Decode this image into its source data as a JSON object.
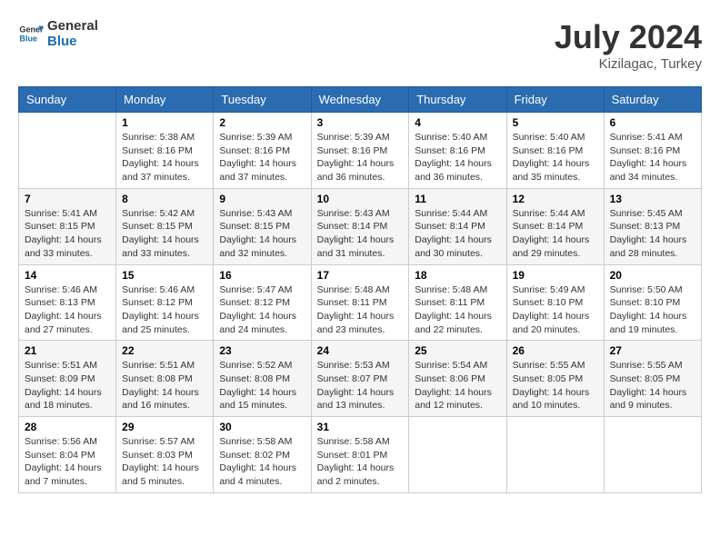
{
  "logo": {
    "text_general": "General",
    "text_blue": "Blue"
  },
  "title": {
    "month_year": "July 2024",
    "location": "Kizilagac, Turkey"
  },
  "days_of_week": [
    "Sunday",
    "Monday",
    "Tuesday",
    "Wednesday",
    "Thursday",
    "Friday",
    "Saturday"
  ],
  "weeks": [
    [
      {
        "day": "",
        "empty": true
      },
      {
        "day": "1",
        "sunrise": "5:38 AM",
        "sunset": "8:16 PM",
        "daylight": "14 hours and 37 minutes."
      },
      {
        "day": "2",
        "sunrise": "5:39 AM",
        "sunset": "8:16 PM",
        "daylight": "14 hours and 37 minutes."
      },
      {
        "day": "3",
        "sunrise": "5:39 AM",
        "sunset": "8:16 PM",
        "daylight": "14 hours and 36 minutes."
      },
      {
        "day": "4",
        "sunrise": "5:40 AM",
        "sunset": "8:16 PM",
        "daylight": "14 hours and 36 minutes."
      },
      {
        "day": "5",
        "sunrise": "5:40 AM",
        "sunset": "8:16 PM",
        "daylight": "14 hours and 35 minutes."
      },
      {
        "day": "6",
        "sunrise": "5:41 AM",
        "sunset": "8:16 PM",
        "daylight": "14 hours and 34 minutes."
      }
    ],
    [
      {
        "day": "7",
        "sunrise": "5:41 AM",
        "sunset": "8:15 PM",
        "daylight": "14 hours and 33 minutes."
      },
      {
        "day": "8",
        "sunrise": "5:42 AM",
        "sunset": "8:15 PM",
        "daylight": "14 hours and 33 minutes."
      },
      {
        "day": "9",
        "sunrise": "5:43 AM",
        "sunset": "8:15 PM",
        "daylight": "14 hours and 32 minutes."
      },
      {
        "day": "10",
        "sunrise": "5:43 AM",
        "sunset": "8:14 PM",
        "daylight": "14 hours and 31 minutes."
      },
      {
        "day": "11",
        "sunrise": "5:44 AM",
        "sunset": "8:14 PM",
        "daylight": "14 hours and 30 minutes."
      },
      {
        "day": "12",
        "sunrise": "5:44 AM",
        "sunset": "8:14 PM",
        "daylight": "14 hours and 29 minutes."
      },
      {
        "day": "13",
        "sunrise": "5:45 AM",
        "sunset": "8:13 PM",
        "daylight": "14 hours and 28 minutes."
      }
    ],
    [
      {
        "day": "14",
        "sunrise": "5:46 AM",
        "sunset": "8:13 PM",
        "daylight": "14 hours and 27 minutes."
      },
      {
        "day": "15",
        "sunrise": "5:46 AM",
        "sunset": "8:12 PM",
        "daylight": "14 hours and 25 minutes."
      },
      {
        "day": "16",
        "sunrise": "5:47 AM",
        "sunset": "8:12 PM",
        "daylight": "14 hours and 24 minutes."
      },
      {
        "day": "17",
        "sunrise": "5:48 AM",
        "sunset": "8:11 PM",
        "daylight": "14 hours and 23 minutes."
      },
      {
        "day": "18",
        "sunrise": "5:48 AM",
        "sunset": "8:11 PM",
        "daylight": "14 hours and 22 minutes."
      },
      {
        "day": "19",
        "sunrise": "5:49 AM",
        "sunset": "8:10 PM",
        "daylight": "14 hours and 20 minutes."
      },
      {
        "day": "20",
        "sunrise": "5:50 AM",
        "sunset": "8:10 PM",
        "daylight": "14 hours and 19 minutes."
      }
    ],
    [
      {
        "day": "21",
        "sunrise": "5:51 AM",
        "sunset": "8:09 PM",
        "daylight": "14 hours and 18 minutes."
      },
      {
        "day": "22",
        "sunrise": "5:51 AM",
        "sunset": "8:08 PM",
        "daylight": "14 hours and 16 minutes."
      },
      {
        "day": "23",
        "sunrise": "5:52 AM",
        "sunset": "8:08 PM",
        "daylight": "14 hours and 15 minutes."
      },
      {
        "day": "24",
        "sunrise": "5:53 AM",
        "sunset": "8:07 PM",
        "daylight": "14 hours and 13 minutes."
      },
      {
        "day": "25",
        "sunrise": "5:54 AM",
        "sunset": "8:06 PM",
        "daylight": "14 hours and 12 minutes."
      },
      {
        "day": "26",
        "sunrise": "5:55 AM",
        "sunset": "8:05 PM",
        "daylight": "14 hours and 10 minutes."
      },
      {
        "day": "27",
        "sunrise": "5:55 AM",
        "sunset": "8:05 PM",
        "daylight": "14 hours and 9 minutes."
      }
    ],
    [
      {
        "day": "28",
        "sunrise": "5:56 AM",
        "sunset": "8:04 PM",
        "daylight": "14 hours and 7 minutes."
      },
      {
        "day": "29",
        "sunrise": "5:57 AM",
        "sunset": "8:03 PM",
        "daylight": "14 hours and 5 minutes."
      },
      {
        "day": "30",
        "sunrise": "5:58 AM",
        "sunset": "8:02 PM",
        "daylight": "14 hours and 4 minutes."
      },
      {
        "day": "31",
        "sunrise": "5:58 AM",
        "sunset": "8:01 PM",
        "daylight": "14 hours and 2 minutes."
      },
      {
        "day": "",
        "empty": true
      },
      {
        "day": "",
        "empty": true
      },
      {
        "day": "",
        "empty": true
      }
    ]
  ]
}
